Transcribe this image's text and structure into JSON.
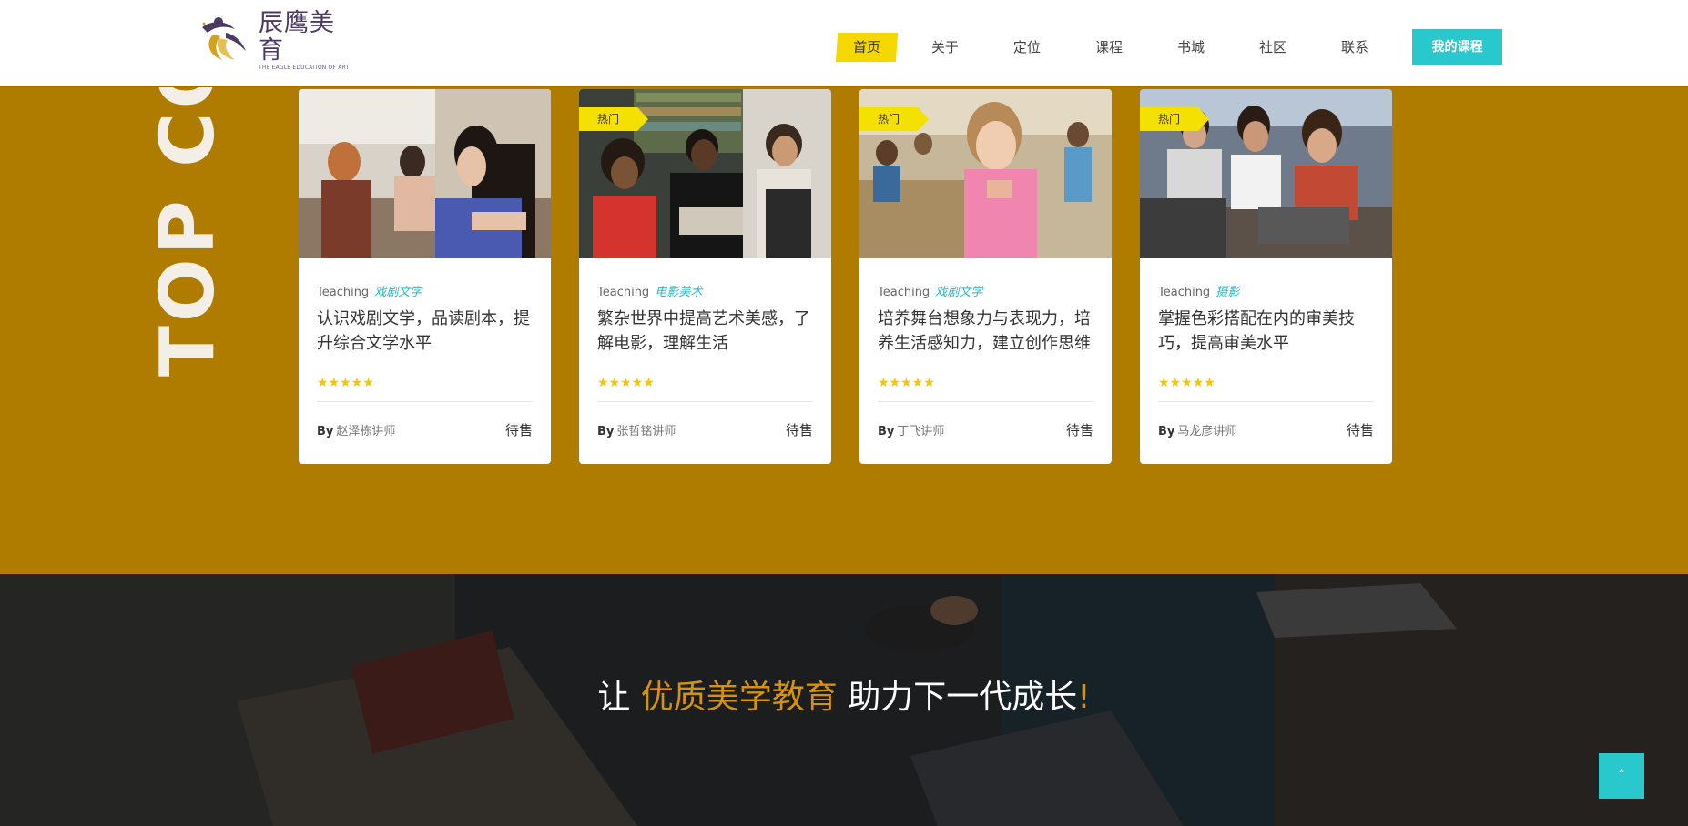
{
  "logo": {
    "name_cn": "辰鹰美育",
    "name_en": "THE EAGLE EDUCATION OF ART"
  },
  "nav": {
    "items": [
      "首页",
      "关于",
      "定位",
      "课程",
      "书城",
      "社区",
      "联系"
    ],
    "cta": "我的课程"
  },
  "section": {
    "vertical_title": "TOP COU"
  },
  "cards": [
    {
      "badge": "",
      "teaching": "Teaching",
      "category": "戏剧文学",
      "title": "认识戏剧文学，品读剧本，提升综合文学水平",
      "rating": 5,
      "by": "By",
      "author": "赵泽栋讲师",
      "price": "待售",
      "photo": "people-cafe"
    },
    {
      "badge": "热门",
      "teaching": "Teaching",
      "category": "电影美术",
      "title": "繁杂世界中提高艺术美感，了解电影，理解生活",
      "rating": 5,
      "by": "By",
      "author": "张哲铭讲师",
      "price": "待售",
      "photo": "students-library"
    },
    {
      "badge": "热门",
      "teaching": "Teaching",
      "category": "戏剧文学",
      "title": "培养舞台想象力与表现力，培养生活感知力，建立创作思维",
      "rating": 5,
      "by": "By",
      "author": "丁飞讲师",
      "price": "待售",
      "photo": "kids-classroom"
    },
    {
      "badge": "热门",
      "teaching": "Teaching",
      "category": "摄影",
      "title": "掌握色彩搭配在内的审美技巧，提高审美水平",
      "rating": 5,
      "by": "By",
      "author": "马龙彦讲师",
      "price": "待售",
      "photo": "teens-laptops"
    }
  ],
  "banner": {
    "prefix": "让 ",
    "highlight": "优质美学教育",
    "suffix": " 助力下一代成长",
    "exclaim": "!"
  },
  "back_to_top": "˄",
  "colors": {
    "accent_yellow": "#f5d800",
    "teal": "#28c8cc",
    "gold_bg": "#b07c00",
    "highlight_orange": "#d4920d"
  }
}
